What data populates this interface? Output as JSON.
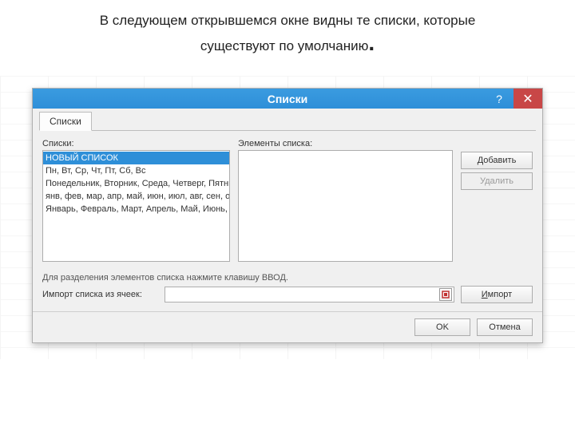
{
  "caption_line1": "В следующем открывшемся окне видны те списки, которые",
  "caption_line2": "существуют по умолчанию",
  "dialog": {
    "title": "Списки",
    "tab_label": "Списки",
    "lists_label": "Списки:",
    "items_label": "Элементы списка:",
    "lists": [
      "НОВЫЙ СПИСОК",
      "Пн, Вт, Ср, Чт, Пт, Сб, Вс",
      "Понедельник, Вторник, Среда, Четверг, Пятница,",
      "янв, фев, мар, апр, май, июн, июл, авг, сен, окт, но",
      "Январь, Февраль, Март, Апрель, Май, Июнь, Июль,"
    ],
    "selected_index": 0,
    "add_label": "Добавить",
    "delete_label": "Удалить",
    "hint_text": "Для разделения элементов списка нажмите клавишу ВВОД.",
    "import_from_label": "Импорт списка из ячеек:",
    "import_label": "Импорт",
    "ok_label": "OK",
    "cancel_label": "Отмена"
  }
}
